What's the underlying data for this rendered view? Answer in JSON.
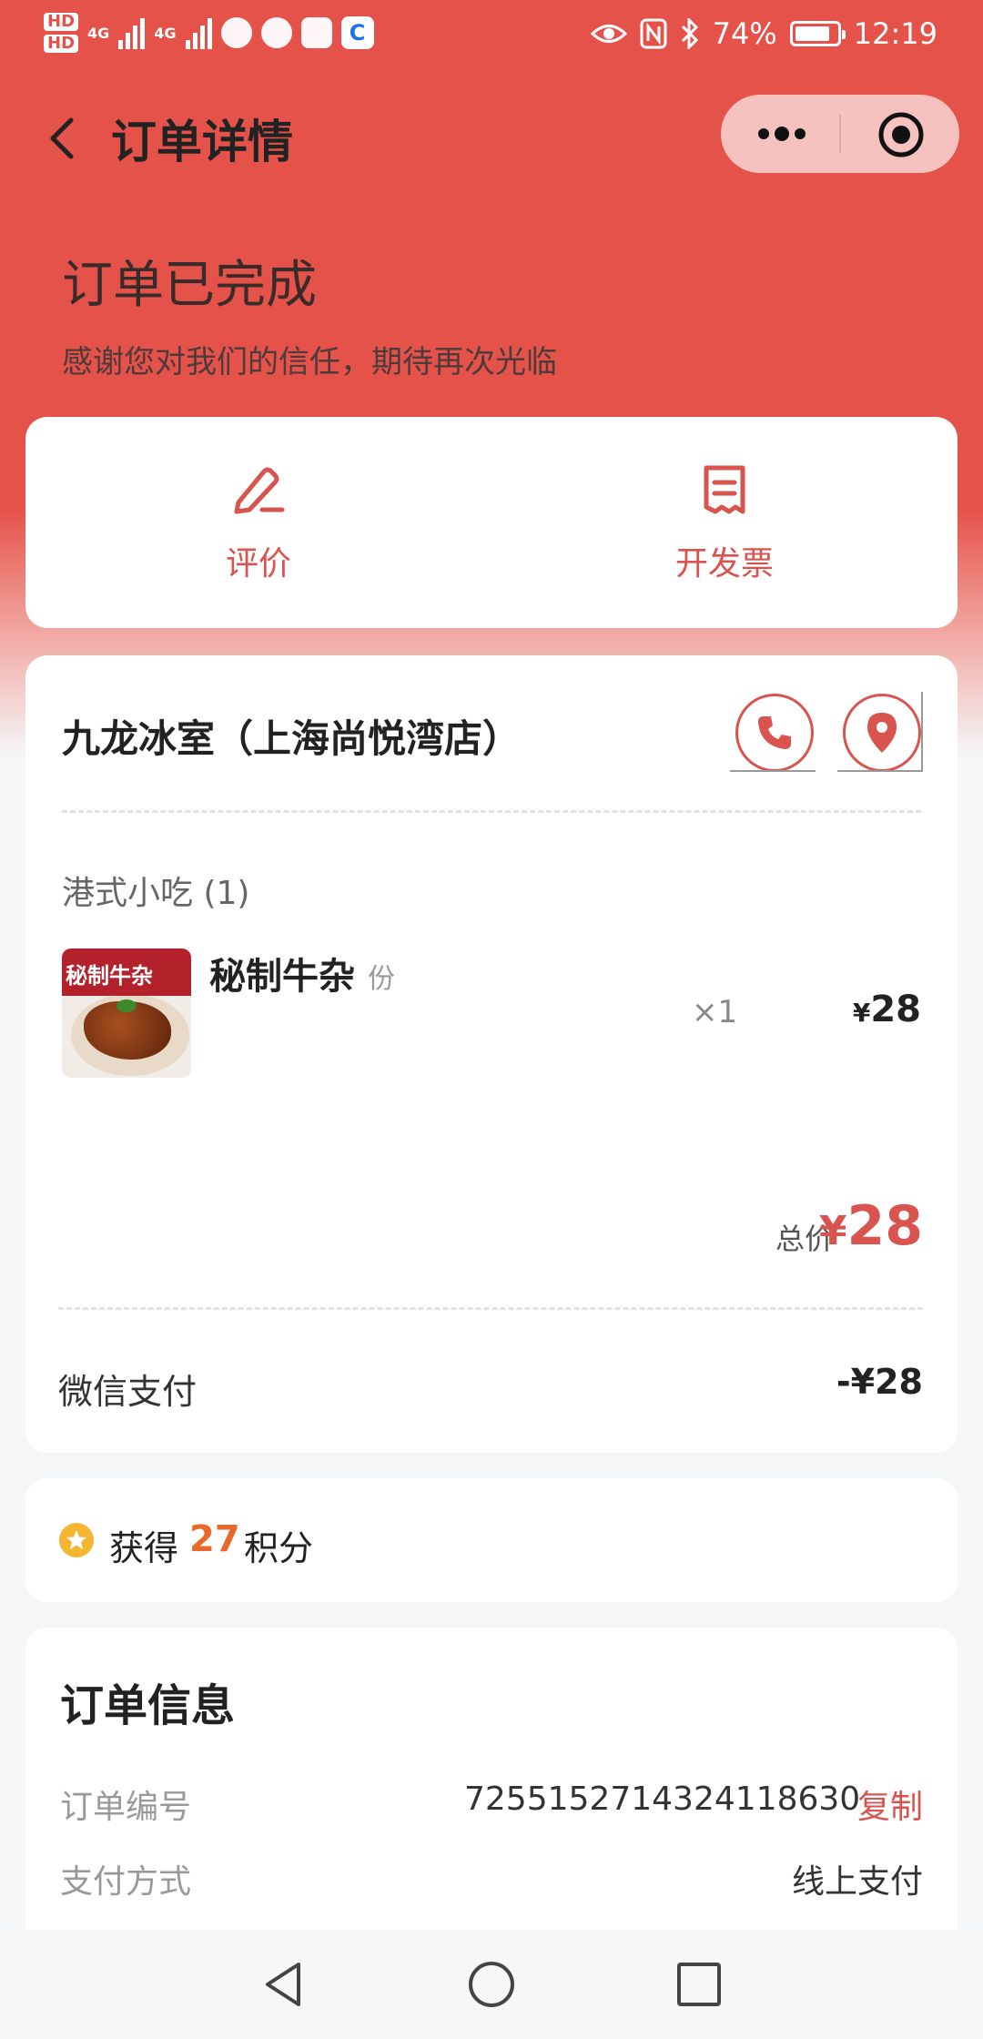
{
  "status_bar": {
    "hd_1": "HD",
    "hd_2": "HD",
    "net_1": "4G",
    "net_2": "4G",
    "battery": "74%",
    "time": "12:19",
    "app_glyph": "C"
  },
  "nav": {
    "title": "订单详情",
    "icons": [
      "back-icon",
      "more-icon",
      "close-icon"
    ]
  },
  "order_status": {
    "title": "订单已完成",
    "subtitle": "感谢您对我们的信任，期待再次光临"
  },
  "actions": [
    {
      "label": "评价",
      "icon": "review-edit-icon"
    },
    {
      "label": "开发票",
      "icon": "invoice-icon"
    }
  ],
  "store": {
    "name": "九龙冰室（上海尚悦湾店）",
    "icons": [
      "phone-icon",
      "location-icon"
    ]
  },
  "order": {
    "category": "港式小吃 (1)",
    "items": [
      {
        "name": "秘制牛杂",
        "unit": "份",
        "qty": "×1",
        "currency": "¥",
        "price": "28",
        "image_text": "秘制牛杂"
      }
    ],
    "total_label": "总价",
    "total_currency": "¥",
    "total": "28",
    "payment_method": "微信支付",
    "payment_amount": "-¥28"
  },
  "points": {
    "prefix": "获得",
    "value": "27",
    "suffix": "积分"
  },
  "order_info": {
    "title": "订单信息",
    "order_no_label": "订单编号",
    "order_no": "7255152714324118630",
    "copy_label": "复制",
    "pay_type_label": "支付方式",
    "pay_type": "线上支付"
  },
  "colors": {
    "brand_red": "#e5524a",
    "accent_red": "#d9534f",
    "points_orange": "#e8692a",
    "star_yellow": "#f5b530"
  }
}
